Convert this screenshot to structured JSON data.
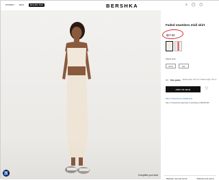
{
  "header": {
    "nav": [
      "WOMEN",
      "MEN"
    ],
    "sub_brand": "Bershka Teen",
    "brand": "BERSHKA",
    "icons": [
      "search-icon",
      "user-icon",
      "bag-icon"
    ]
  },
  "photo": {
    "complete_look": "Complete your look"
  },
  "product": {
    "title": "Faded seamless midi skirt",
    "price": "$27.90",
    "price_ring_color": "#d9252e",
    "select_size_label": "Select size",
    "sizes": [
      "XS-S",
      "M-L"
    ],
    "size_guide": "Size guide",
    "fit_note": "Model height: 167.5 cm / Model height: 175 cm",
    "add_to_bag": "ADD TO BAG",
    "installments": "Pay in interest-free installments",
    "pay_note": "Pay in 4 interest-free payments on purchases of $30-$1,500",
    "bottom_links": [
      "Materials, care and source",
      "Deliveries and returns"
    ]
  }
}
